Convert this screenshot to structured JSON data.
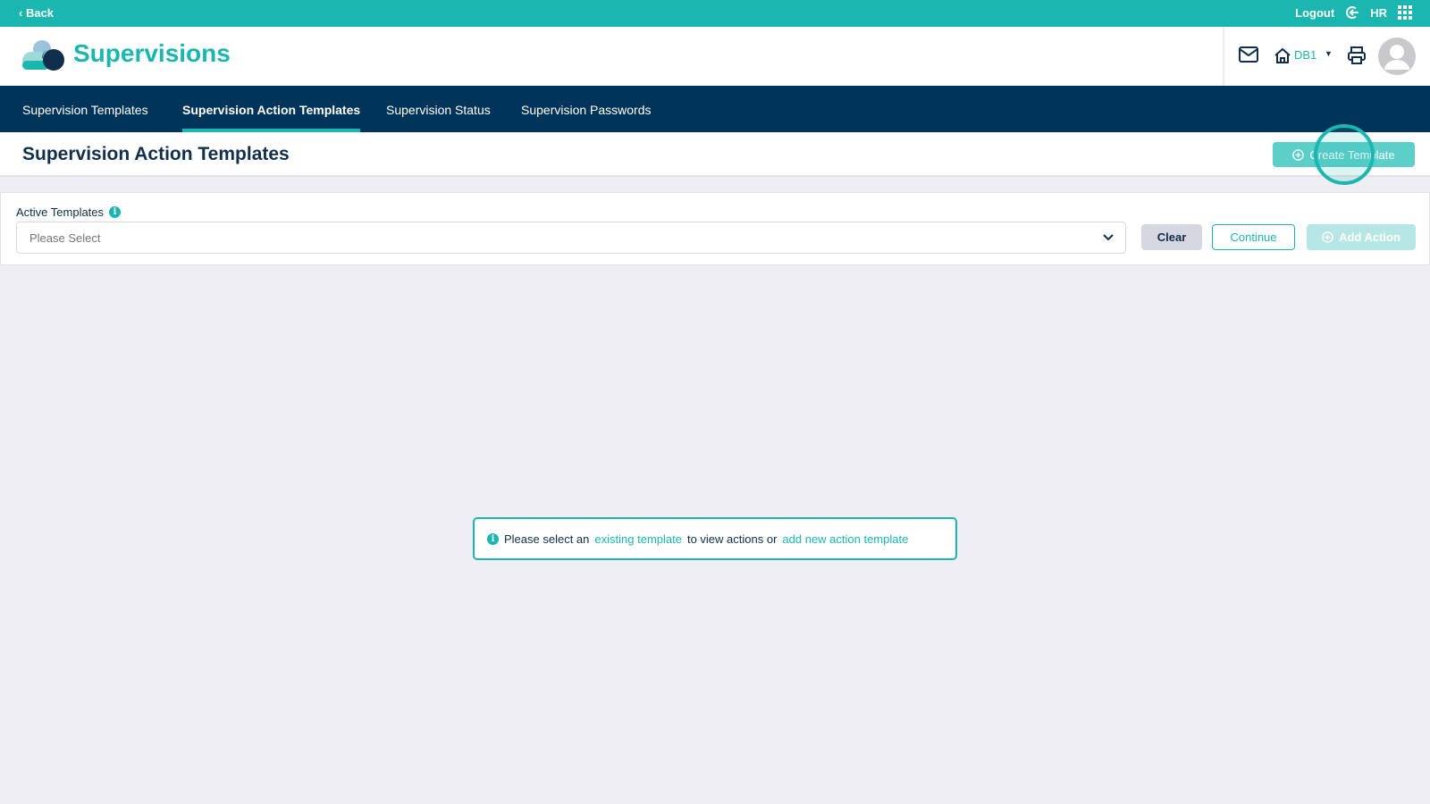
{
  "topbar": {
    "back": "Back",
    "logout": "Logout",
    "user_initials": "HR"
  },
  "header": {
    "app_title": "Supervisions",
    "location": "DB1"
  },
  "nav": {
    "tabs": [
      {
        "label": "Supervision Templates"
      },
      {
        "label": "Supervision Action Templates",
        "active": true
      },
      {
        "label": "Supervision Status"
      },
      {
        "label": "Supervision Passwords"
      }
    ]
  },
  "page": {
    "title": "Supervision Action Templates",
    "create_button": "Create Template"
  },
  "filter": {
    "label": "Active Templates",
    "placeholder": "Please Select",
    "clear": "Clear",
    "continue": "Continue",
    "add_action": "Add Action"
  },
  "message": {
    "prefix": "Please select an",
    "link1": "existing template",
    "middle": "to view actions or",
    "link2": "add new action template"
  },
  "colors": {
    "accent": "#1bb6b0",
    "nav": "#003459"
  }
}
